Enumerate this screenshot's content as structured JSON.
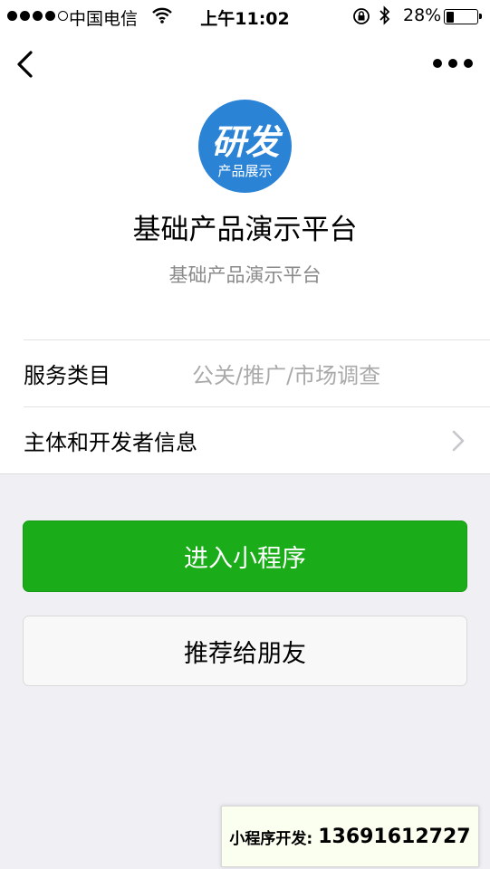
{
  "status_bar": {
    "carrier": "中国电信",
    "time": "上午11:02",
    "battery_percent": "28%",
    "battery_level": 0.28,
    "icons": [
      "signal-dots",
      "wifi-icon",
      "rotation-lock-icon",
      "bluetooth-icon",
      "battery-icon"
    ]
  },
  "nav": {
    "back_icon": "chevron-left-icon",
    "more_icon": "more-dots-icon"
  },
  "logo": {
    "main_text": "研发",
    "sub_text": "产品展示",
    "color": "#2b83d6"
  },
  "app": {
    "name": "基础产品演示平台",
    "description": "基础产品演示平台"
  },
  "info": {
    "service_label": "服务类目",
    "service_value": "公关/推广/市场调查",
    "developer_label": "主体和开发者信息"
  },
  "buttons": {
    "enter_label": "进入小程序",
    "share_label": "推荐给朋友",
    "enter_color": "#1aad19"
  },
  "contact": {
    "label": "小程序开发:",
    "number": "13691612727"
  }
}
